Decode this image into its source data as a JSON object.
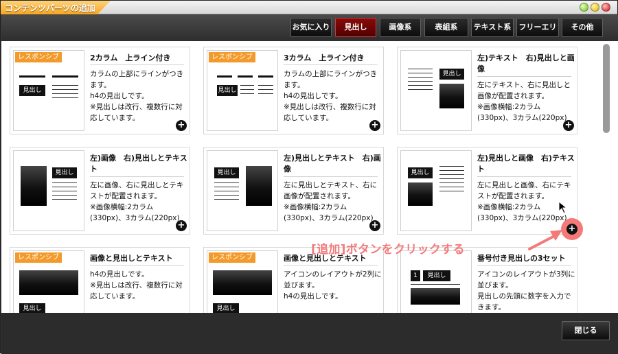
{
  "window": {
    "title": "コンテンツパーツの追加"
  },
  "tabs": [
    {
      "label": "お気に入り",
      "active": false
    },
    {
      "label": "見出し",
      "active": true
    },
    {
      "label": "画像系",
      "active": false
    },
    {
      "label": "表組系",
      "active": false
    },
    {
      "label": "テキスト系",
      "active": false
    },
    {
      "label": "フリーエリア",
      "active": false
    },
    {
      "label": "その他",
      "active": false
    }
  ],
  "badge": "レスポンシブ",
  "thumb_label": "見出し",
  "add_icon": "+",
  "cards": [
    {
      "title": "2カラム　上ライン付き",
      "desc": "カラムの上部にラインがつきます。\nh4の見出しです。\n※見出しは改行、複数行に対応しています。",
      "responsive": true
    },
    {
      "title": "3カラム　上ライン付き",
      "desc": "カラムの上部にラインがつきます。\nh4の見出しです。\n※見出しは改行、複数行に対応しています。",
      "responsive": true
    },
    {
      "title": "左)テキスト　右)見出しと画像",
      "desc": "左にテキスト、右に見出しと画像が配置されます。\n※画像横幅:2カラム\n(330px)、3カラム(220px)",
      "responsive": false
    },
    {
      "title": "左)画像　右)見出しとテキスト",
      "desc": "左に画像、右に見出しとテキストが配置されます。\n※画像横幅:2カラム\n(330px)、3カラム(220px)",
      "responsive": false
    },
    {
      "title": "左)見出しとテキスト　右)画像",
      "desc": "左に見出しとテキスト、右に画像が配置されます。\n※画像横幅:2カラム\n(330px)、3カラム(220px)",
      "responsive": false
    },
    {
      "title": "左)見出しと画像　右)テキスト",
      "desc": "左に見出しと画像、右にテキストが配置されます。\n※画像横幅:2カラム\n(330px)、3カラム(220px)",
      "responsive": false
    },
    {
      "title": "画像と見出しとテキスト",
      "desc": "h4の見出しです。\n※見出しは改行、複数行に対応しています。",
      "responsive": true
    },
    {
      "title": "画像と見出しとテキスト",
      "desc": "アイコンのレイアウトが2列に並びます。\nh4の見出しです。",
      "responsive": true
    },
    {
      "title": "番号付き見出しの3セット",
      "desc": "アイコンのレイアウトが3列に並びます。\n見出しの先頭に数字を入力できます。",
      "responsive": false
    }
  ],
  "annotation": "[追加]ボタンをクリックする",
  "number_badge": "1",
  "footer": {
    "close_label": "閉じる"
  },
  "colors": {
    "accent": "#f39a2a",
    "active_tab": "#7a0000",
    "highlight": "#f47a7a"
  }
}
